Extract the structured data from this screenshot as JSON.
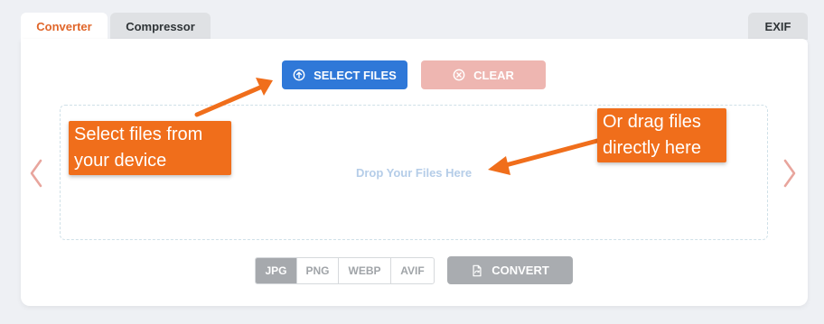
{
  "tabs": {
    "converter": "Converter",
    "compressor": "Compressor",
    "exif": "EXIF"
  },
  "actions": {
    "select_files": "SELECT FILES",
    "clear": "CLEAR",
    "convert": "CONVERT"
  },
  "dropzone": {
    "text": "Drop Your Files Here"
  },
  "formats": [
    "JPG",
    "PNG",
    "WEBP",
    "AVIF"
  ],
  "selected_format": "JPG",
  "callouts": {
    "left_line1": "Select files from",
    "left_line2": "your device",
    "right_line1": "Or drag files",
    "right_line2": "directly here"
  },
  "colors": {
    "accent_tab": "#e0662a",
    "primary": "#2f78d8",
    "clear": "#eeb6b1",
    "callout": "#f06e1b",
    "nav_arrow": "#e8a59d"
  },
  "icons": {
    "select": "upload-circle-icon",
    "clear": "x-circle-icon",
    "convert": "convert-file-icon",
    "prev": "chevron-left-icon",
    "next": "chevron-right-icon"
  }
}
